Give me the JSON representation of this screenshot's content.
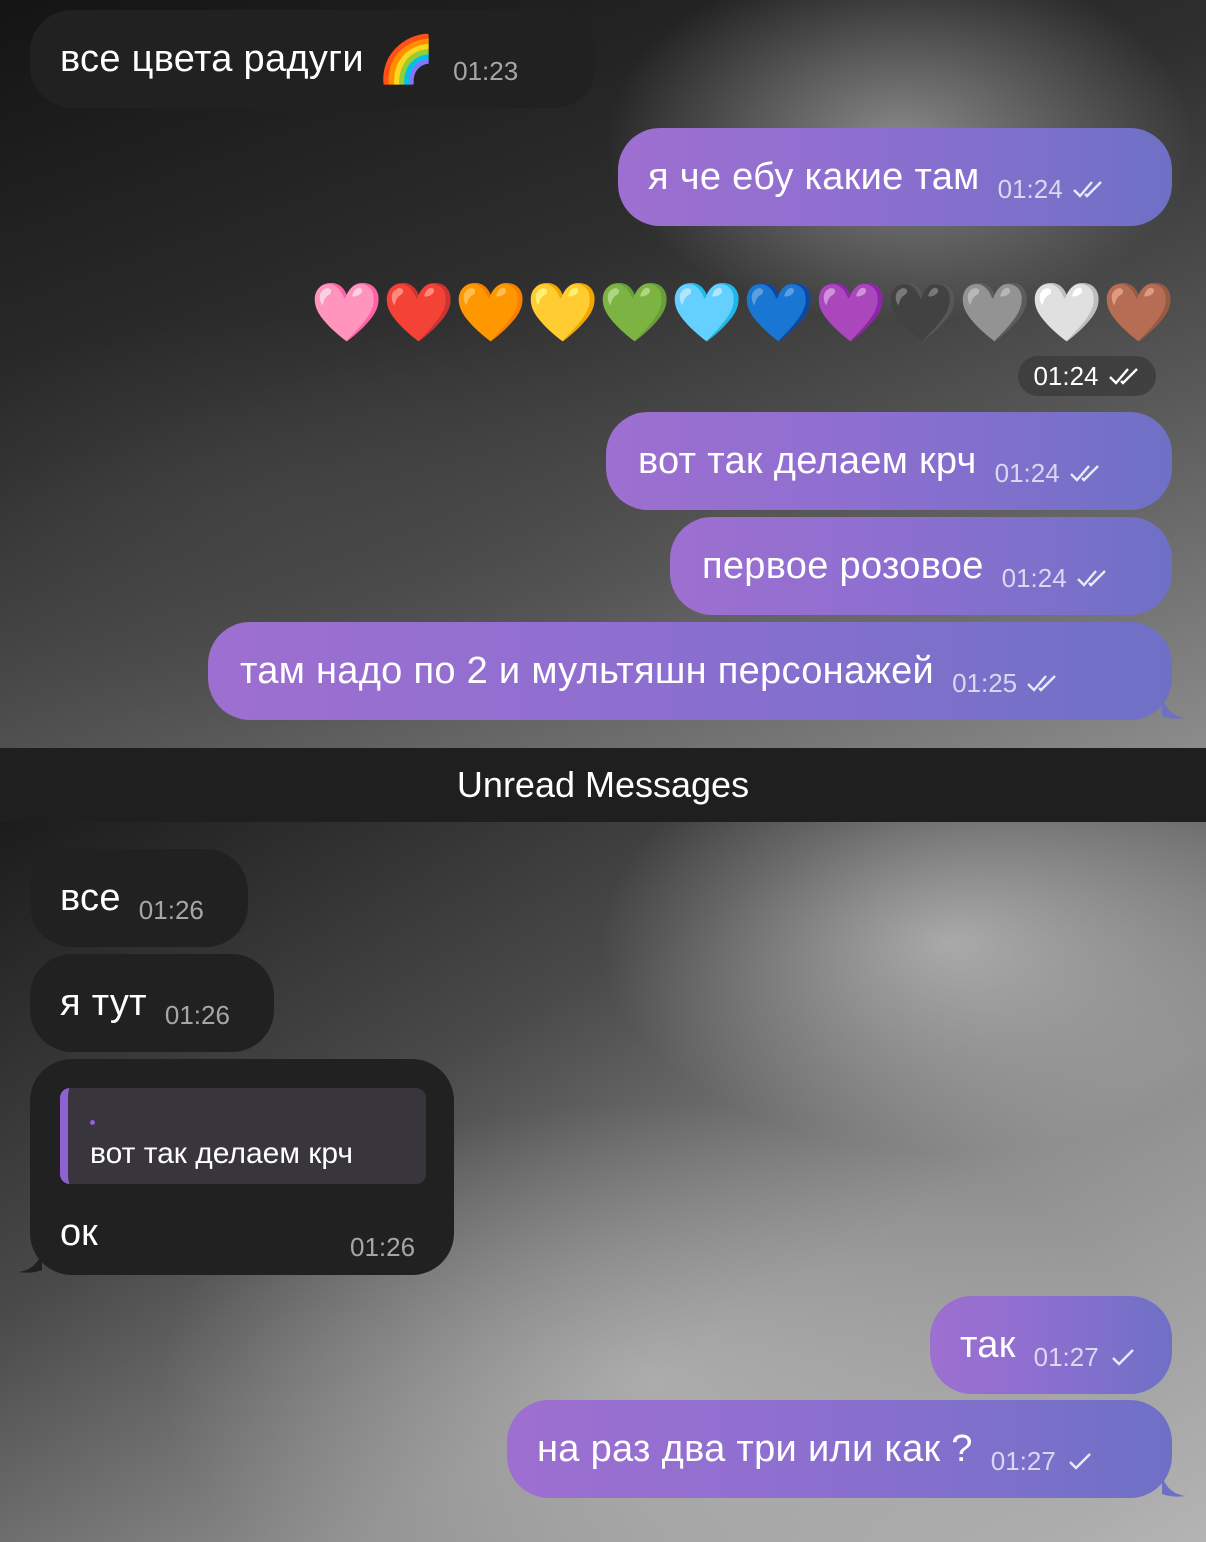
{
  "chat": {
    "unread_divider": "Unread Messages",
    "messages": [
      {
        "text": "все цвета радуги",
        "emoji": "🌈",
        "time": "01:23"
      },
      {
        "text": "я че ебу какие там",
        "time": "01:24"
      },
      {
        "emoji_row": [
          "🩷",
          "❤️",
          "🧡",
          "💛",
          "💚",
          "🩵",
          "💙",
          "💜",
          "🖤",
          "🩶",
          "🤍",
          "🤎"
        ],
        "time": "01:24"
      },
      {
        "text": "вот так делаем крч",
        "time": "01:24"
      },
      {
        "text": "первое розовое",
        "time": "01:24"
      },
      {
        "text": "там надо по 2 и мультяшн персонажей",
        "time": "01:25"
      },
      {
        "text": "все",
        "time": "01:26"
      },
      {
        "text": "я тут",
        "time": "01:26"
      },
      {
        "reply_marker": ".",
        "reply_quote": "вот так делаем крч",
        "text": "ок",
        "time": "01:26"
      },
      {
        "text": "так",
        "time": "01:27"
      },
      {
        "text": "на раз два три или как ?",
        "time": "01:27"
      }
    ]
  },
  "icons": {
    "read_receipt": "double-check-icon",
    "sent_receipt": "single-check-icon"
  },
  "colors": {
    "outgoing_start": "#9d6fd0",
    "outgoing_end": "#6e70c6",
    "incoming": "#212121",
    "reply_accent": "#8e62d1"
  }
}
